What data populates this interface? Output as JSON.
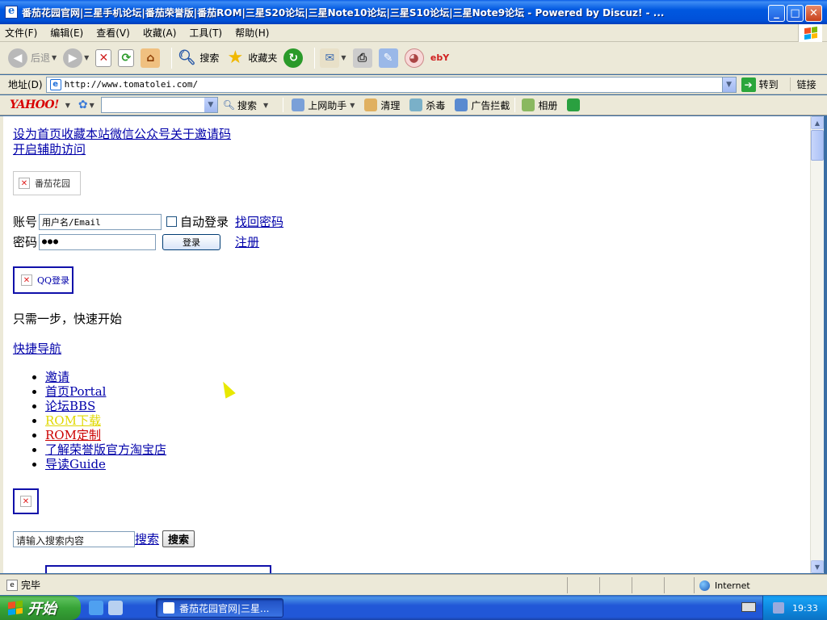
{
  "window": {
    "title": "番茄花园官网|三星手机论坛|番茄荣誉版|番茄ROM|三星S20论坛|三星Note10论坛|三星S10论坛|三星Note9论坛 - Powered by Discuz! - ...",
    "minimize_glyph": "_",
    "maximize_glyph": "□",
    "close_glyph": "✕"
  },
  "menubar": {
    "items": [
      "文件(F)",
      "编辑(E)",
      "查看(V)",
      "收藏(A)",
      "工具(T)",
      "帮助(H)"
    ]
  },
  "toolbar": {
    "back_label": "后退",
    "search_label": "搜索",
    "favorites_label": "收藏夹"
  },
  "addressbar": {
    "label": "地址(D)",
    "url": "http://www.tomatolei.com/",
    "go_label": "转到",
    "links_label": "链接"
  },
  "yahoo_toolbar": {
    "logo": "YAHOO!",
    "search_label": "搜索",
    "helper_label": "上网助手",
    "clean_label": "清理",
    "antivirus_label": "杀毒",
    "adblock_label": "广告拦截",
    "album_label": "相册"
  },
  "page": {
    "top_links_line1": "设为首页收藏本站微信公众号关于邀请码",
    "top_links_line2": "开启辅助访问",
    "logo_alt": "番茄花园",
    "login": {
      "account_label": "账号",
      "account_value": "用户名/Email",
      "auto_login_label": "自动登录",
      "forgot_label": "找回密码",
      "password_label": "密码",
      "password_value": "●●●",
      "login_button": "登录",
      "register_label": "注册"
    },
    "qq_login_alt": "QQ登录",
    "one_step": "只需一步，快速开始",
    "quick_nav": "快捷导航",
    "nav_items": [
      {
        "label": "邀请",
        "color": "#0000aa"
      },
      {
        "label": "首页Portal",
        "color": "#0000aa"
      },
      {
        "label": "论坛BBS",
        "color": "#0000aa"
      },
      {
        "label": "ROM下载",
        "color": "#e0d800"
      },
      {
        "label": "ROM定制",
        "color": "#cc0000"
      },
      {
        "label": "了解荣誉版官方淘宝店",
        "color": "#0000aa"
      },
      {
        "label": "导读Guide",
        "color": "#0000aa"
      }
    ],
    "search_placeholder": "请输入搜索内容",
    "search_link": "搜索",
    "search_button": "搜索"
  },
  "statusbar": {
    "status_text": "完毕",
    "zone_label": "Internet"
  },
  "taskbar": {
    "start_label": "开始",
    "task_title": "番茄花园官网|三星...",
    "clock": "19:33"
  },
  "colors": {
    "titlebar": "#0058e0",
    "chrome": "#ece9d8",
    "link": "#0000aa",
    "yahoo_red": "#d80000",
    "start_green": "#37a437"
  }
}
